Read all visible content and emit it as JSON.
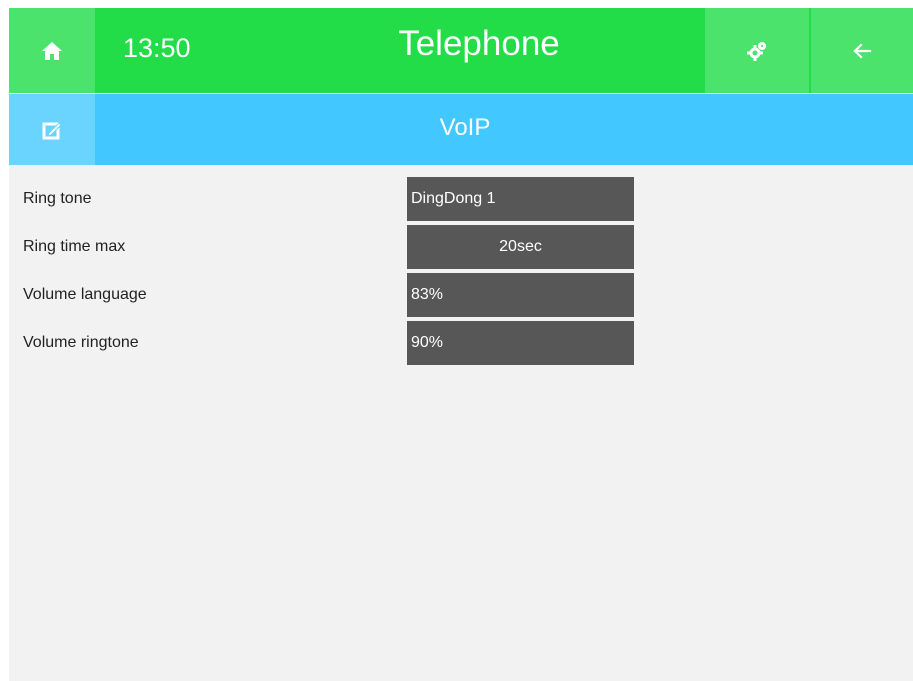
{
  "header": {
    "home_icon": "home-icon",
    "time": "13:50",
    "title": "Telephone",
    "settings_icon": "gear-icon",
    "back_icon": "arrow-left-icon"
  },
  "subheader": {
    "edit_icon": "edit-icon",
    "title": "VoIP"
  },
  "settings": [
    {
      "label": "Ring tone",
      "value": "DingDong 1"
    },
    {
      "label": "Ring time max",
      "value": "20sec"
    },
    {
      "label": "Volume language",
      "value": "83%"
    },
    {
      "label": "Volume ringtone",
      "value": "90%"
    }
  ],
  "colors": {
    "header_green": "#22dc48",
    "button_green": "#4be36c",
    "subheader_blue": "#42c8fe",
    "button_blue": "#6bd4fe",
    "value_box": "#575757",
    "background": "#f2f2f2"
  }
}
